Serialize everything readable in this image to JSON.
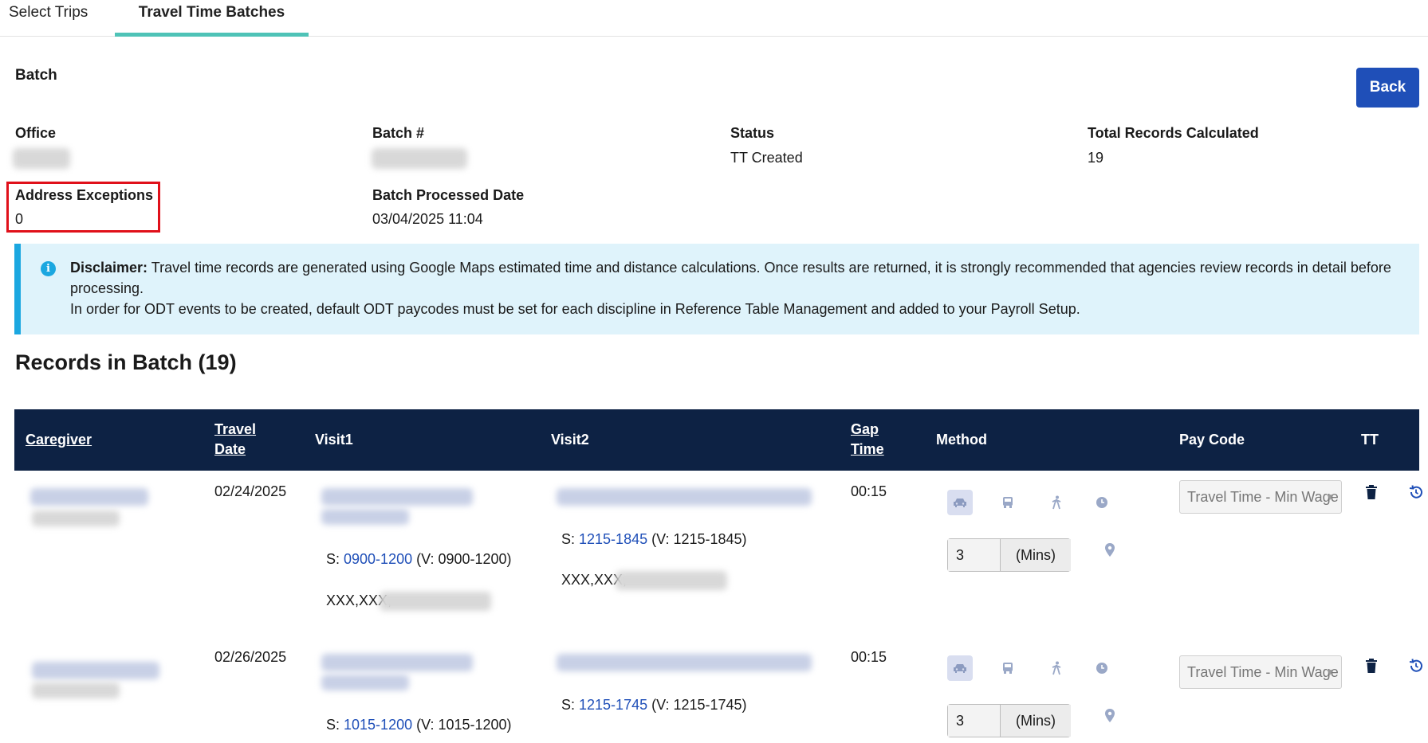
{
  "tabs": [
    {
      "label": "Select Trips"
    },
    {
      "label": "Travel Time Batches"
    }
  ],
  "batch": {
    "title": "Batch",
    "back_label": "Back",
    "office_label": "Office",
    "batch_no_label": "Batch #",
    "status_label": "Status",
    "status_value": "TT Created",
    "total_label": "Total Records Calculated",
    "total_value": "19",
    "address_exc_label": "Address Exceptions",
    "address_exc_value": "0",
    "processed_label": "Batch Processed Date",
    "processed_value": "03/04/2025 11:04"
  },
  "disclaimer": {
    "heading": "Disclaimer:",
    "line1": "Travel time records are generated using Google Maps estimated time and distance calculations. Once results are returned, it is strongly recommended that agencies review records in detail before processing.",
    "line2": "In order for ODT events to be created, default ODT paycodes must be set for each discipline in Reference Table Management and added to your Payroll Setup."
  },
  "records": {
    "title": "Records in Batch (19)",
    "columns": {
      "caregiver": "Caregiver",
      "travel": "Travel",
      "date": "Date",
      "visit1": "Visit1",
      "visit2": "Visit2",
      "gap": "Gap",
      "time": "Time",
      "method": "Method",
      "pay_code": "Pay Code",
      "tt": "TT"
    },
    "rows": [
      {
        "travel_date": "02/24/2025",
        "visit1_s_prefix": "S: ",
        "visit1_s_link": "0900-1200",
        "visit1_s_v": " (V: 0900-1200)",
        "visit1_addr": "XXX,XXX,",
        "visit2_s_prefix": "S: ",
        "visit2_s_link": "1215-1845",
        "visit2_s_v": " (V: 1215-1845)",
        "visit2_addr": "XXX,XXX,",
        "gap_time": "00:15",
        "mins_value": "3",
        "mins_unit": "(Mins)",
        "pay_code": "Travel Time - Min Wage"
      },
      {
        "travel_date": "02/26/2025",
        "visit1_s_prefix": "S: ",
        "visit1_s_link": "1015-1200",
        "visit1_s_v": " (V: 1015-1200)",
        "visit2_s_prefix": "S: ",
        "visit2_s_link": "1215-1745",
        "visit2_s_v": " (V: 1215-1745)",
        "gap_time": "00:15",
        "mins_value": "3",
        "mins_unit": "(Mins)",
        "pay_code": "Travel Time - Min Wage"
      }
    ]
  },
  "icons": {
    "info": "info-icon",
    "car": "car-icon",
    "bus": "bus-icon",
    "walk": "walk-icon",
    "clock": "clock-icon",
    "pin": "map-pin-icon",
    "trash": "trash-icon",
    "undo": "history-icon"
  },
  "colors": {
    "header_bg": "#0d2244",
    "tab_accent": "#4fc3b7",
    "primary_button": "#1f4fb8",
    "disclaimer_bg": "#dff3fb",
    "disclaimer_accent": "#1ba7e0",
    "highlight_box": "#e0101a",
    "link": "#1f4fb8"
  }
}
